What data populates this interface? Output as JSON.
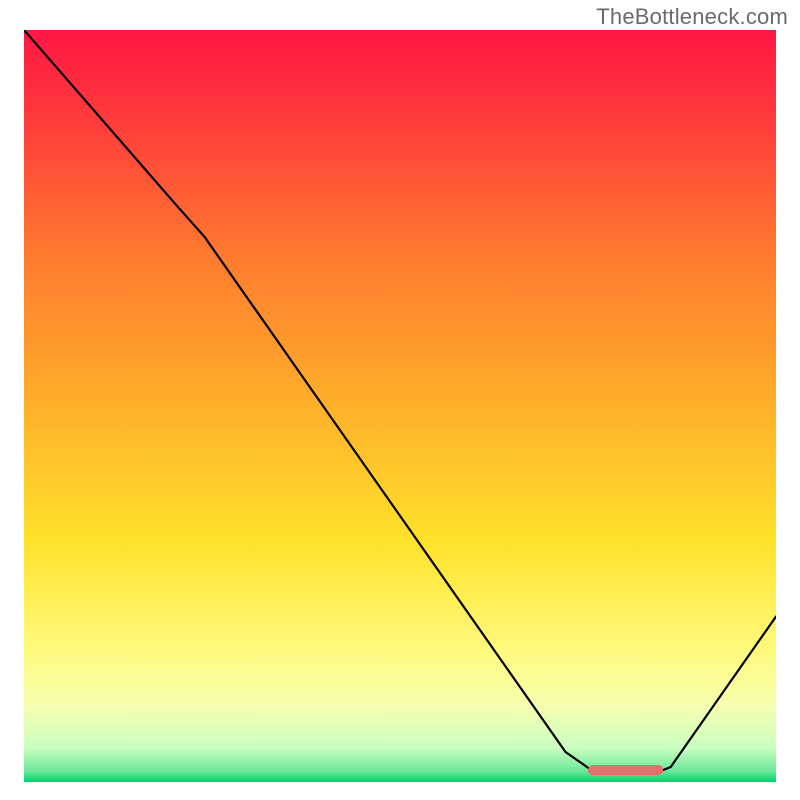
{
  "watermark": "TheBottleneck.com",
  "chart_data": {
    "type": "line",
    "title": "",
    "xlabel": "",
    "ylabel": "",
    "xlim": [
      0,
      100
    ],
    "ylim": [
      0,
      100
    ],
    "grid": false,
    "legend": false,
    "background_gradient": {
      "stops": [
        {
          "offset": 0.0,
          "color": "#ff1744"
        },
        {
          "offset": 0.12,
          "color": "#ff3b3b"
        },
        {
          "offset": 0.3,
          "color": "#ff7a2f"
        },
        {
          "offset": 0.5,
          "color": "#ffb02a"
        },
        {
          "offset": 0.68,
          "color": "#ffe12a"
        },
        {
          "offset": 0.82,
          "color": "#fff97a"
        },
        {
          "offset": 0.9,
          "color": "#f6ffb0"
        },
        {
          "offset": 0.955,
          "color": "#c8ffc0"
        },
        {
          "offset": 0.985,
          "color": "#6fe89a"
        },
        {
          "offset": 1.0,
          "color": "#00d36b"
        }
      ]
    },
    "series": [
      {
        "name": "bottleneck-curve",
        "color": "#000000",
        "width": 2.2,
        "points": [
          {
            "x": 0,
            "y": 100
          },
          {
            "x": 20,
            "y": 77
          },
          {
            "x": 24,
            "y": 72.5
          },
          {
            "x": 72,
            "y": 4
          },
          {
            "x": 76,
            "y": 1.2
          },
          {
            "x": 84,
            "y": 1.2
          },
          {
            "x": 86,
            "y": 2
          },
          {
            "x": 100,
            "y": 22
          }
        ]
      }
    ],
    "marker": {
      "name": "optimal-range-marker",
      "color": "#e86d6d",
      "y": 1.6,
      "x_start": 75,
      "x_end": 85,
      "thickness": 10,
      "rounded": true
    }
  }
}
